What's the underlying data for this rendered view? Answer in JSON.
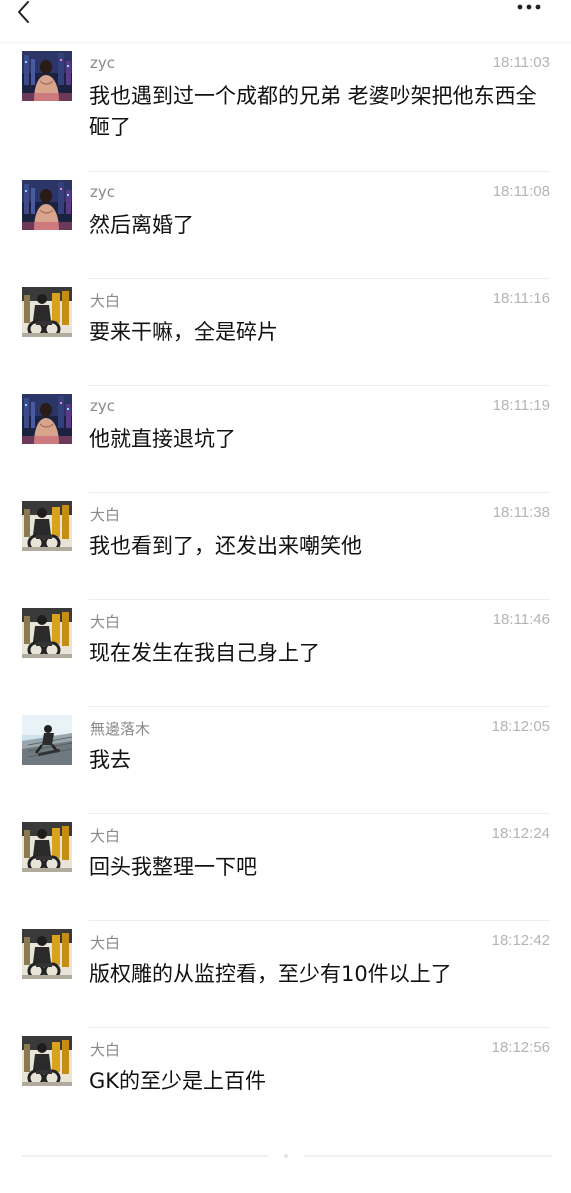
{
  "header": {
    "back_icon": "chevron-left-icon",
    "more_icon": "more-horizontal-icon"
  },
  "messages": [
    {
      "user": "zyc",
      "time": "18:11:03",
      "text": "我也遇到过一个成都的兄弟 老婆吵架把他东西全砸了",
      "avatar": "zyc-avatar"
    },
    {
      "user": "zyc",
      "time": "18:11:08",
      "text": "然后离婚了",
      "avatar": "zyc-avatar"
    },
    {
      "user": "大白",
      "time": "18:11:16",
      "text": "要来干嘛，全是碎片",
      "avatar": "dabai-avatar"
    },
    {
      "user": "zyc",
      "time": "18:11:19",
      "text": "他就直接退坑了",
      "avatar": "zyc-avatar"
    },
    {
      "user": "大白",
      "time": "18:11:38",
      "text": "我也看到了，还发出来嘲笑他",
      "avatar": "dabai-avatar"
    },
    {
      "user": "大白",
      "time": "18:11:46",
      "text": "现在发生在我自己身上了",
      "avatar": "dabai-avatar"
    },
    {
      "user": "無邊落木",
      "time": "18:12:05",
      "text": "我去",
      "avatar": "wubian-avatar"
    },
    {
      "user": "大白",
      "time": "18:12:24",
      "text": "回头我整理一下吧",
      "avatar": "dabai-avatar"
    },
    {
      "user": "大白",
      "time": "18:12:42",
      "text": "版权雕的从监控看，至少有10件以上了",
      "avatar": "dabai-avatar"
    },
    {
      "user": "大白",
      "time": "18:12:56",
      "text": "GK的至少是上百件",
      "avatar": "dabai-avatar"
    }
  ]
}
